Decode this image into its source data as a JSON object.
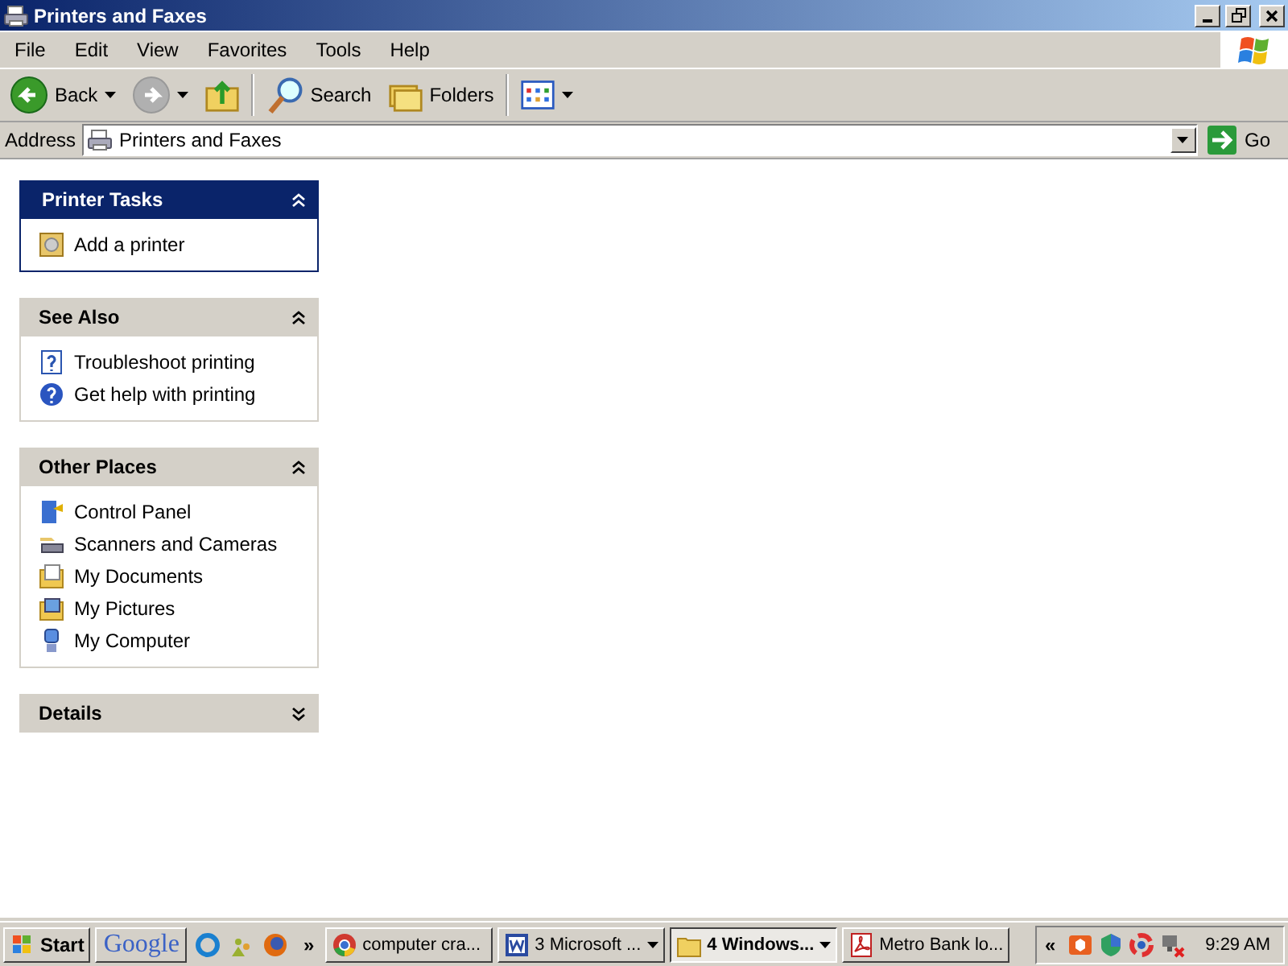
{
  "window": {
    "title": "Printers and Faxes"
  },
  "menu": [
    "File",
    "Edit",
    "View",
    "Favorites",
    "Tools",
    "Help"
  ],
  "toolbar": [
    {
      "kind": "back",
      "label": "Back",
      "disabled": false
    },
    {
      "kind": "forward",
      "disabled": true
    },
    {
      "kind": "up"
    },
    {
      "kind": "search",
      "label": "Search"
    },
    {
      "kind": "folders",
      "label": "Folders"
    },
    {
      "kind": "views"
    }
  ],
  "address": {
    "label": "Address",
    "value": "Printers and Faxes",
    "go": "Go"
  },
  "panels": [
    {
      "title": "Printer Tasks",
      "kind": "special",
      "expanded": true,
      "items": [
        {
          "kind": "add-printer",
          "label": "Add a printer"
        }
      ]
    },
    {
      "title": "See Also",
      "kind": "normal",
      "expanded": true,
      "items": [
        {
          "kind": "help-page",
          "label": "Troubleshoot printing"
        },
        {
          "kind": "help",
          "label": "Get help with printing"
        }
      ]
    },
    {
      "title": "Other Places",
      "kind": "normal",
      "expanded": true,
      "items": [
        {
          "kind": "control-panel",
          "label": "Control Panel"
        },
        {
          "kind": "scanner",
          "label": "Scanners and Cameras"
        },
        {
          "kind": "documents",
          "label": "My Documents"
        },
        {
          "kind": "pictures",
          "label": "My Pictures"
        },
        {
          "kind": "computer",
          "label": "My Computer"
        }
      ]
    },
    {
      "title": "Details",
      "kind": "normal",
      "expanded": false
    }
  ],
  "taskbar": {
    "start": "Start",
    "quick_launch": [
      {
        "kind": "google",
        "label": "Google"
      },
      {
        "kind": "ring"
      },
      {
        "kind": "people"
      },
      {
        "kind": "firefox"
      }
    ],
    "more": "»",
    "tasks": [
      {
        "kind": "chrome",
        "label": "computer cra...",
        "selected": false,
        "grouped": false
      },
      {
        "kind": "word",
        "label": "3 Microsoft ...",
        "selected": false,
        "grouped": true
      },
      {
        "kind": "folder",
        "label": "4 Windows...",
        "selected": true,
        "grouped": true
      },
      {
        "kind": "pdf",
        "label": "Metro Bank lo...",
        "selected": false,
        "grouped": false
      }
    ],
    "tray": {
      "expand": "«",
      "icons": [
        {
          "kind": "cube"
        },
        {
          "kind": "shield"
        },
        {
          "kind": "swirl"
        },
        {
          "kind": "network"
        }
      ],
      "clock": "9:29 AM"
    }
  }
}
